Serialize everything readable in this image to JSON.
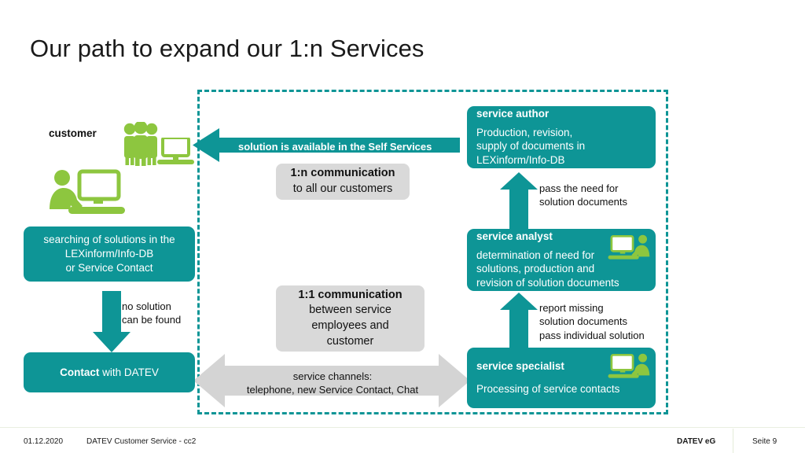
{
  "slide": {
    "title": "Our path to expand our 1:n Services",
    "accent_teal": "#0e9596",
    "accent_green": "#8dc63f",
    "gray": "#d9d9d9"
  },
  "labels": {
    "customer": "customer",
    "no_solution_l1": "no solution",
    "no_solution_l2": "can be found",
    "pass_need_l1": "pass the need for",
    "pass_need_l2": "solution documents",
    "report_l1": "report missing",
    "report_l2": "solution documents",
    "report_l3": "pass individual solution"
  },
  "arrows": {
    "self_service_text": "solution is available in the Self Services",
    "service_channels_l1": "service channels:",
    "service_channels_l2": "telephone, new Service Contact, Chat"
  },
  "boxes": {
    "service_author": {
      "heading": "service author",
      "body_l1": "Production, revision,",
      "body_l2": "supply of documents in",
      "body_l3": "LEXinform/Info-DB"
    },
    "service_analyst": {
      "heading": "service analyst",
      "body_l1": "determination of need for",
      "body_l2": "solutions, production and",
      "body_l3": "revision of solution documents"
    },
    "service_specialist": {
      "heading": "service specialist",
      "body_l1": "Processing of service contacts"
    },
    "searching": {
      "l1": "searching of solutions in the",
      "l2": "LEXinform/Info-DB",
      "l3": "or Service Contact"
    },
    "contact_datev": {
      "strong": "Contact",
      "rest": " with DATEV"
    },
    "comm_1n": {
      "l1": "1:n communication",
      "l2": "to all our customers"
    },
    "comm_11": {
      "l1": "1:1 communication",
      "l2": "between service",
      "l3": "employees and",
      "l4": "customer"
    }
  },
  "icons": {
    "customer_group": "people-group-icon",
    "customer_monitor": "monitor-icon",
    "customer_workstation": "person-at-computer-icon",
    "analyst_workstation": "person-at-computer-icon",
    "specialist_workstation": "person-at-computer-icon"
  },
  "footer": {
    "date": "01.12.2020",
    "department": "DATEV Customer Service - cc2",
    "company": "DATEV eG",
    "page": "Seite 9"
  }
}
